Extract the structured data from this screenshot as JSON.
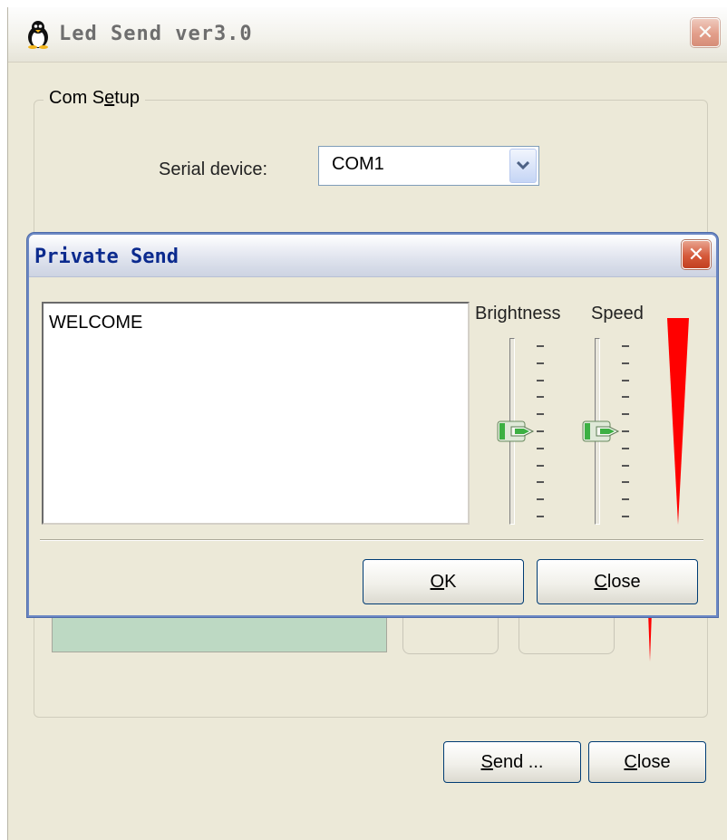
{
  "main_window": {
    "title": "Led Send ver3.0",
    "close_glyph": "✕",
    "com_setup": {
      "label_before": "Com S",
      "label_mnemonic": "e",
      "label_after": "tup",
      "serial_label": "Serial device:",
      "serial_value": "COM1"
    },
    "send_button": {
      "mnemonic": "S",
      "rest": "end ..."
    },
    "close_button": {
      "mnemonic": "C",
      "rest": "lose"
    }
  },
  "dialog": {
    "title": "Private Send",
    "close_glyph": "✕",
    "message": "WELCOME",
    "brightness_label": "Brightness",
    "speed_label": "Speed",
    "brightness_level": 0.5,
    "speed_level": 0.5,
    "ok_button": {
      "mnemonic": "O",
      "rest": "K"
    },
    "close_button": {
      "mnemonic": "C",
      "rest": "lose"
    }
  },
  "colors": {
    "window_bg": "#ECE9D8",
    "dialog_title_text": "#0b2a8e",
    "display_box": "#bdd9c3",
    "red_indicator": "#ff0000",
    "slider_thumb": "#3cb043"
  },
  "icons": [
    "penguin-icon",
    "close-icon",
    "chevron-down-icon",
    "slider-thumb-icon"
  ]
}
